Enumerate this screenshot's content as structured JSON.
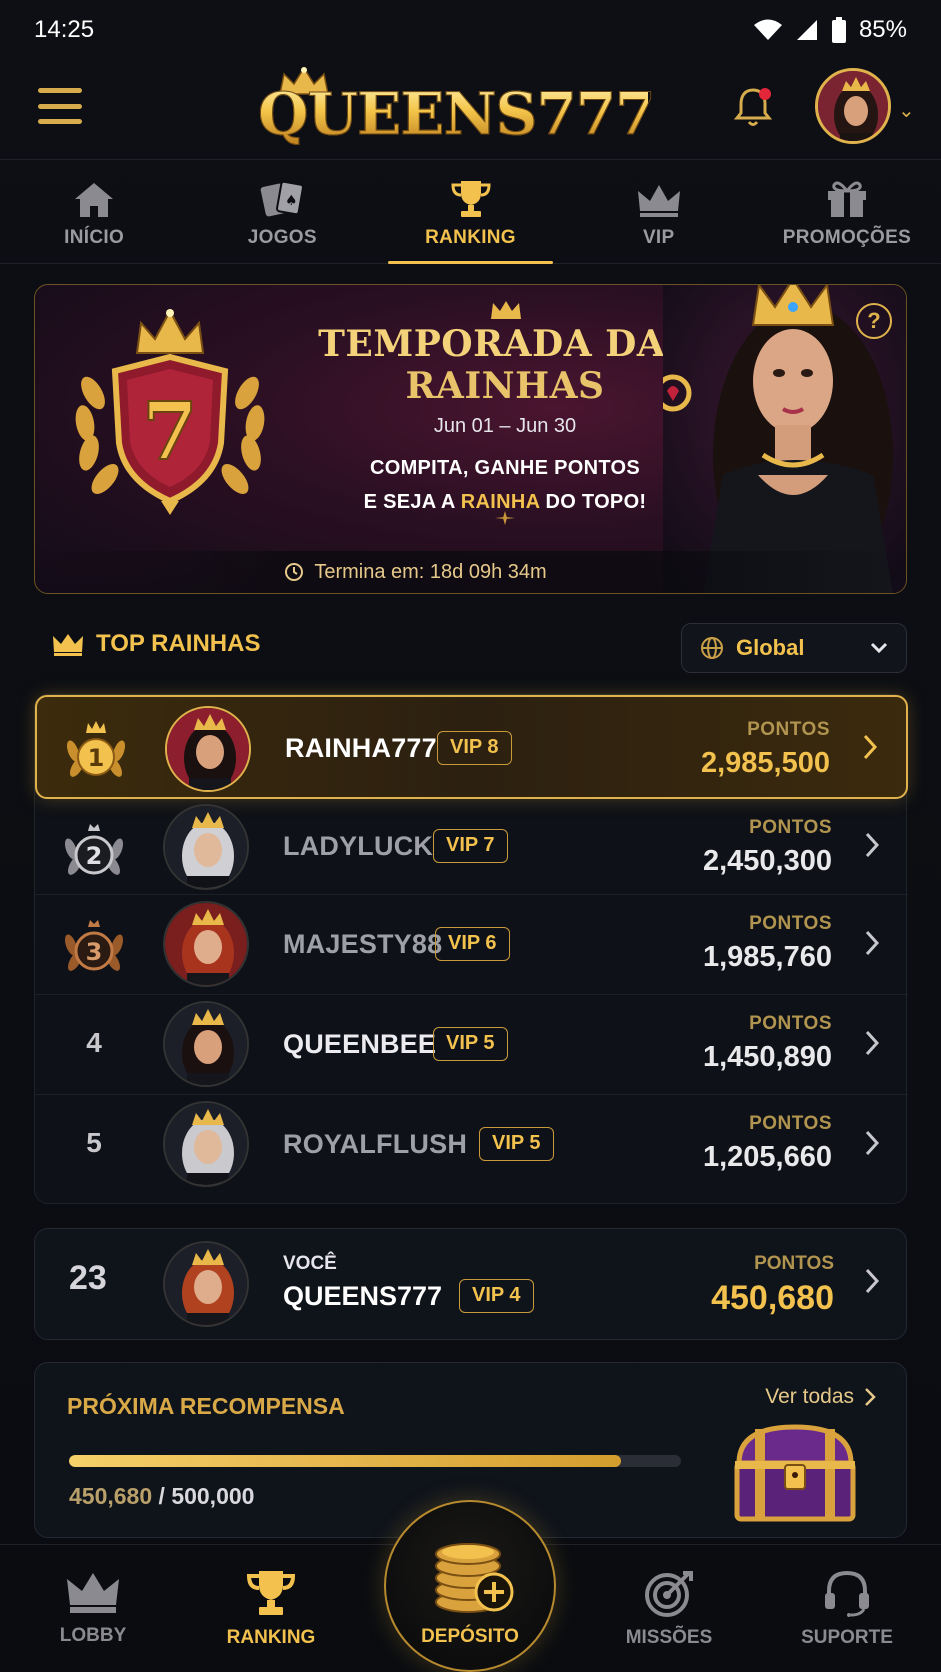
{
  "status_bar": {
    "time": "14:25",
    "battery": "85%"
  },
  "header": {
    "logo_text": "QUEENS777"
  },
  "top_nav": {
    "tabs": [
      {
        "label": "INÍCIO",
        "icon": "home-icon",
        "active": false
      },
      {
        "label": "JOGOS",
        "icon": "cards-icon",
        "active": false
      },
      {
        "label": "RANKING",
        "icon": "trophy-icon",
        "active": true
      },
      {
        "label": "VIP",
        "icon": "crown-icon",
        "active": false
      },
      {
        "label": "PROMOÇÕES",
        "icon": "gift-icon",
        "active": false
      }
    ]
  },
  "banner": {
    "emblem_number": "7",
    "title_line1": "TEMPORADA DAS",
    "title_line2": "RAINHAS",
    "dates": "Jun 01 – Jun 30",
    "desc_line1": "COMPITA, GANHE PONTOS",
    "desc_line2_a": "E SEJA A ",
    "desc_line2_highlight": "RAINHA",
    "desc_line2_b": " DO TOPO!",
    "help": "?",
    "timer_label": "Termina em: 18d 09h 34m"
  },
  "section": {
    "title": "TOP RAINHAS",
    "filter_value": "Global"
  },
  "leaderboard": {
    "points_label": "PONTOS",
    "rows": [
      {
        "rank": "1",
        "name": "RAINHA777",
        "vip": "VIP 8",
        "points": "2,985,500"
      },
      {
        "rank": "2",
        "name": "LADYLUCK",
        "vip": "VIP 7",
        "points": "2,450,300"
      },
      {
        "rank": "3",
        "name": "MAJESTY88",
        "vip": "VIP 6",
        "points": "1,985,760"
      },
      {
        "rank": "4",
        "name": "QUEENBEE",
        "vip": "VIP 5",
        "points": "1,450,890"
      },
      {
        "rank": "5",
        "name": "ROYALFLUSH",
        "vip": "VIP 5",
        "points": "1,205,660"
      }
    ]
  },
  "me": {
    "rank": "23",
    "you_label": "VOCÊ",
    "name": "QUEENS777",
    "vip": "VIP 4",
    "points_label": "PONTOS",
    "points": "450,680"
  },
  "reward": {
    "title": "PRÓXIMA RECOMPENSA",
    "see_all": "Ver todas",
    "current": "450,680",
    "separator": " / ",
    "target": "500,000",
    "progress_fraction": 0.90136
  },
  "bottom_nav": {
    "lobby": "LOBBY",
    "ranking": "RANKING",
    "deposit": "DEPÓSITO",
    "missions": "MISSÕES",
    "support": "SUPORTE"
  },
  "colors": {
    "accent": "#f2c14e",
    "background": "#0b0d12"
  }
}
